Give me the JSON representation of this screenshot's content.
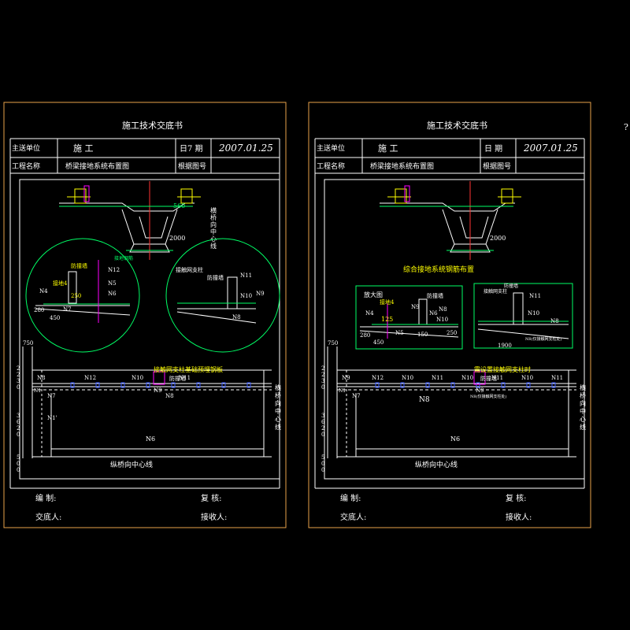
{
  "colors": {
    "frame": "#e8a24a",
    "line": "#ffffff",
    "yellow": "#ffff00",
    "green": "#00ff66",
    "cyan": "#00ffff",
    "magenta": "#ff00ff",
    "red": "#ff3333",
    "blue": "#3355ff"
  },
  "corner_mark": "?",
  "sheets": [
    {
      "header": {
        "title": "施工技术交底书",
        "unit_label": "主送单位",
        "unit_value": "施 工",
        "date_label": "日7 期",
        "date_value": "2007.01.25",
        "project_label": "工程名称",
        "project_value": "桥梁接地系统布置图",
        "basis_label": "根据图号"
      },
      "section_dims": {
        "top": "560",
        "bottom": "2000"
      },
      "section_note": "接地钢筋",
      "center_label": "横桥向中心线",
      "detail_left": {
        "labels": [
          "防撞墙",
          "N12",
          "N5",
          "N6",
          "N4",
          "接地4",
          "N7",
          "250",
          "280",
          "450"
        ]
      },
      "detail_right": {
        "labels": [
          "接触网支柱",
          "防撞墙",
          "N11",
          "N10",
          "N9",
          "N8"
        ]
      },
      "plan_title": "接触网支柱基础预埋钢板",
      "plan_labels": {
        "n_top": [
          "N8",
          "N12",
          "N10",
          "N11"
        ],
        "n7": "N7",
        "n1": "N1",
        "n1b": "N1'",
        "n6": "N6",
        "n9": "N9",
        "fender": "防撞墙",
        "n8_low": "N8"
      },
      "plan_dims": {
        "d750": "750",
        "d2230": "2230",
        "d3620": "3620",
        "d500": "500"
      },
      "axis_vertical": "横桥向中心线",
      "axis_horizontal": "纵桥向中心线",
      "footer": {
        "edit": "编 制:",
        "review": "复 核:",
        "handover": "交底人:",
        "receiver": "接收人:"
      }
    },
    {
      "header": {
        "title": "施工技术交底书",
        "unit_label": "主送单位",
        "unit_value": "施 工",
        "date_label": "日 期",
        "date_value": "2007.01.25",
        "project_label": "工程名称",
        "project_value": "桥梁接地系统布置图",
        "basis_label": "根据图号"
      },
      "section_dims": {
        "bottom": "2000"
      },
      "section_title": "综合接地系统钢筋布置",
      "enlarged_title": "放大图",
      "detail_left": {
        "labels": [
          "防撞墙",
          "接地4",
          "N4",
          "N9",
          "N6",
          "N5",
          "125",
          "N10",
          "N8",
          "250",
          "280",
          "450",
          "150"
        ]
      },
      "detail_right": {
        "labels": [
          "接触网支柱",
          "防撞墙",
          "N11",
          "N10",
          "N8",
          "1900",
          "N8(仅接触网支柱处)"
        ]
      },
      "plan_title": "需设置接触网支柱时",
      "plan_labels": {
        "n_top": [
          "N9",
          "N12",
          "N10",
          "N11",
          "N10",
          "N11",
          "N10",
          "N11"
        ],
        "n7": "N7",
        "n1": "N1",
        "n6": "N6",
        "n8": "N8",
        "n9": "N9",
        "fender": "防撞墙",
        "note": "N8(仅接触网支柱处)"
      },
      "plan_dims": {
        "d750": "750",
        "d2230": "2230",
        "d3620": "3620",
        "d500": "500"
      },
      "axis_vertical": "横桥向中心线",
      "axis_horizontal": "纵桥向中心线",
      "footer": {
        "edit": "编 制:",
        "review": "复 核:",
        "handover": "交底人:",
        "receiver": "接收人:"
      }
    }
  ]
}
